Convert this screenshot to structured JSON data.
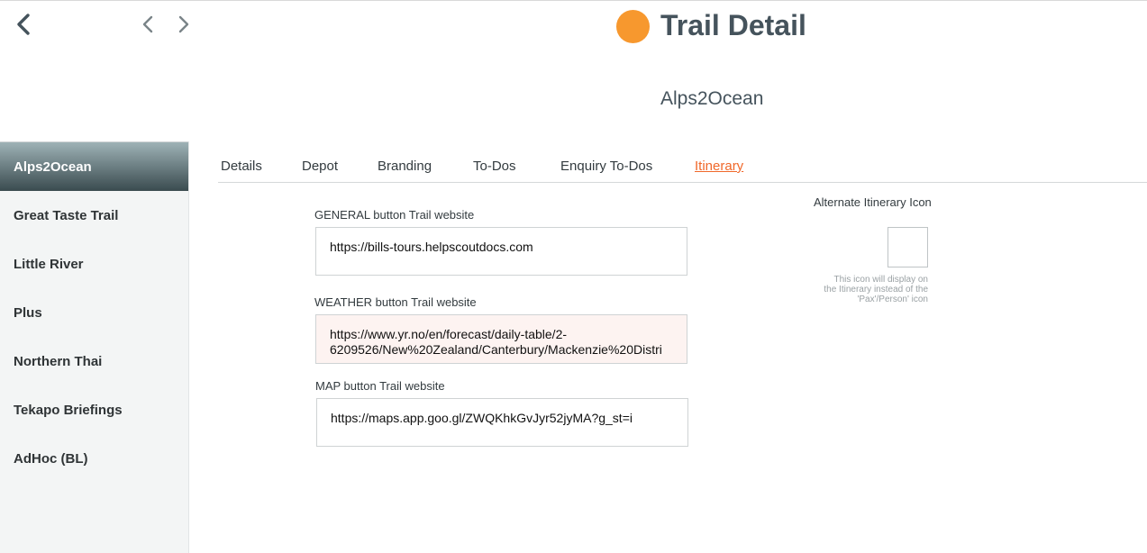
{
  "header": {
    "title": "Trail Detail",
    "subtitle": "Alps2Ocean",
    "title_dot_color": "#f7982e",
    "back_icon": "chevron-left-icon",
    "prev_icon": "chevron-left-icon",
    "next_icon": "chevron-right-icon"
  },
  "sidebar": {
    "items": [
      {
        "label": "Alps2Ocean",
        "active": true
      },
      {
        "label": "Great Taste Trail"
      },
      {
        "label": "Little River"
      },
      {
        "label": "Plus"
      },
      {
        "label": "Northern Thai"
      },
      {
        "label": "Tekapo Briefings"
      },
      {
        "label": "AdHoc (BL)"
      }
    ]
  },
  "tabs": [
    {
      "label": "Details"
    },
    {
      "label": "Depot"
    },
    {
      "label": "Branding"
    },
    {
      "label": "To-Dos"
    },
    {
      "label": "Enquiry To-Dos"
    },
    {
      "label": "Itinerary",
      "active": true
    }
  ],
  "accent_color": "#f0682a",
  "form": {
    "general": {
      "label": "GENERAL button Trail website",
      "value": "https://bills-tours.helpscoutdocs.com"
    },
    "weather": {
      "label": "WEATHER button Trail website",
      "value_line1": "https://www.yr.no/en/forecast/daily-table/2-",
      "value_line2": "6209526/New%20Zealand/Canterbury/Mackenzie%20Distri"
    },
    "map": {
      "label": "MAP button Trail website",
      "value": "https://maps.app.goo.gl/ZWQKhkGvJyr52jyMA?g_st=i"
    }
  },
  "alternate_icon": {
    "label": "Alternate Itinerary Icon",
    "note_line1": "This icon will display on",
    "note_line2": "the Itinerary instead of the",
    "note_line3": "'Pax'/Person' icon"
  }
}
